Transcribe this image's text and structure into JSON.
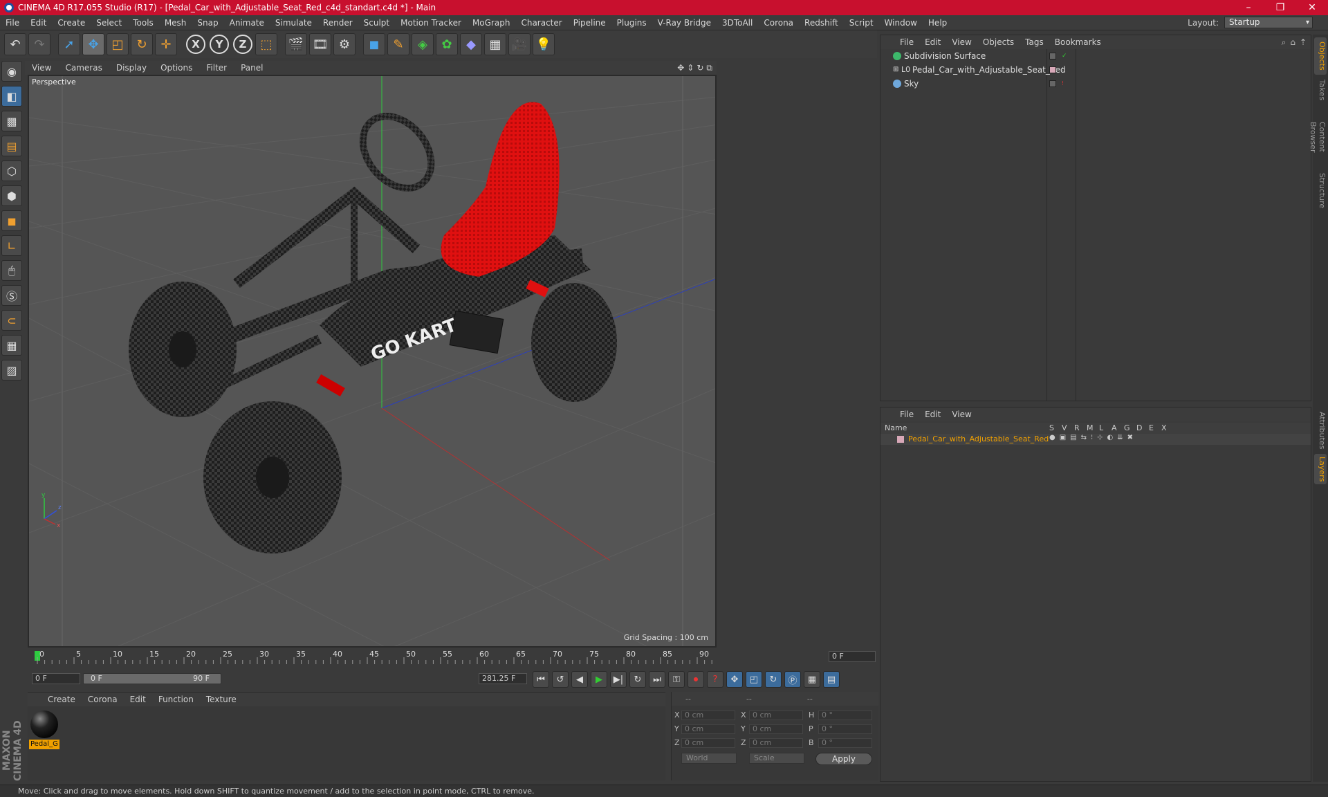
{
  "window": {
    "title": "CINEMA 4D R17.055 Studio (R17) - [Pedal_Car_with_Adjustable_Seat_Red_c4d_standart.c4d *] - Main",
    "controls": [
      "–",
      "❐",
      "✕"
    ]
  },
  "menubar": {
    "items": [
      "File",
      "Edit",
      "Create",
      "Select",
      "Tools",
      "Mesh",
      "Snap",
      "Animate",
      "Simulate",
      "Render",
      "Sculpt",
      "Motion Tracker",
      "MoGraph",
      "Character",
      "Pipeline",
      "Plugins",
      "V-Ray Bridge",
      "3DToAll",
      "Corona",
      "Redshift",
      "Script",
      "Window",
      "Help"
    ],
    "layout_label": "Layout:",
    "layout_value": "Startup"
  },
  "toolbar": {
    "icons": [
      "undo-icon",
      "redo-icon",
      "select-icon",
      "move-icon",
      "scale-icon",
      "rotate-icon",
      "add-icon",
      "x-axis-icon",
      "y-axis-icon",
      "z-axis-icon",
      "coord-system-icon",
      "render-view-icon",
      "render-picture-icon",
      "render-settings-icon",
      "cube-icon",
      "pen-icon",
      "subdivision-icon",
      "cloner-icon",
      "deformer-icon",
      "floor-icon",
      "camera-icon",
      "light-icon"
    ],
    "xyz": [
      "X",
      "Y",
      "Z"
    ]
  },
  "viewport": {
    "menu": [
      "View",
      "Cameras",
      "Display",
      "Options",
      "Filter",
      "Panel"
    ],
    "label": "Perspective",
    "grid_spacing": "Grid Spacing : 100 cm",
    "axis_labels": [
      "y",
      "z",
      "x"
    ],
    "decal_text": "GO KART",
    "colors": {
      "seat": "#e0100f",
      "body": "#1a1a1a",
      "background": "#555555"
    }
  },
  "timeline": {
    "ticks": [
      "0",
      "5",
      "10",
      "15",
      "20",
      "25",
      "30",
      "35",
      "40",
      "45",
      "50",
      "55",
      "60",
      "65",
      "70",
      "75",
      "80",
      "85",
      "90"
    ],
    "frame_display": "0 F"
  },
  "transport": {
    "start_field": "0 F",
    "slider_left": "0 F",
    "slider_right": "90 F",
    "fps_field": "281.25 F"
  },
  "materials": {
    "menu": [
      "Create",
      "Corona",
      "Edit",
      "Function",
      "Texture"
    ],
    "items": [
      {
        "name": "Pedal_G"
      }
    ]
  },
  "coordinates": {
    "headers": [
      "--",
      "--",
      "--"
    ],
    "rows": [
      {
        "a1": "X",
        "v1": "0 cm",
        "a2": "X",
        "v2": "0 cm",
        "a3": "H",
        "v3": "0 °"
      },
      {
        "a1": "Y",
        "v1": "0 cm",
        "a2": "Y",
        "v2": "0 cm",
        "a3": "P",
        "v3": "0 °"
      },
      {
        "a1": "Z",
        "v1": "0 cm",
        "a2": "Z",
        "v2": "0 cm",
        "a3": "B",
        "v3": "0 °"
      }
    ],
    "mode_select": "World",
    "scale_select": "Scale",
    "apply": "Apply"
  },
  "object_manager": {
    "menu": [
      "File",
      "Edit",
      "View",
      "Objects",
      "Tags",
      "Bookmarks"
    ],
    "objects": [
      {
        "name": "Subdivision Surface",
        "icon_color": "#3db86b"
      },
      {
        "name": "Pedal_Car_with_Adjustable_Seat_Red",
        "icon_color": "#cccccc"
      },
      {
        "name": "Sky",
        "icon_color": "#6fa8dc"
      }
    ]
  },
  "layer_manager": {
    "menu": [
      "File",
      "Edit",
      "View"
    ],
    "columns": [
      "Name",
      "S",
      "V",
      "R",
      "M",
      "L",
      "A",
      "G",
      "D",
      "E",
      "X"
    ],
    "layers": [
      {
        "name": "Pedal_Car_with_Adjustable_Seat_Red",
        "color": "#f0a000"
      }
    ]
  },
  "right_tabs": [
    "Objects",
    "Takes",
    "Content Browser",
    "Structure",
    "Attributes",
    "Layers"
  ],
  "status": {
    "text": "Move: Click and drag to move elements. Hold down SHIFT to quantize movement / add to the selection in point mode, CTRL to remove."
  }
}
